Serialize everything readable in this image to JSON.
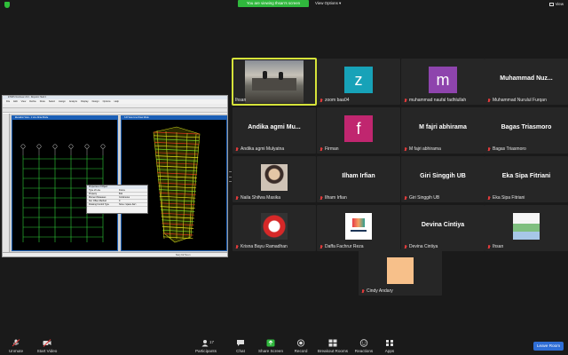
{
  "top": {
    "viewing_label": "You are viewing Ihsan's screen",
    "view_options_label": "View Options ▾",
    "view_label": "View"
  },
  "shared_screen": {
    "app_title": "ETABS Nonlinear v9.0 - fiksjustin Hasil 2",
    "menu": [
      "File",
      "Edit",
      "View",
      "Define",
      "Draw",
      "Select",
      "Assign",
      "Analyze",
      "Display",
      "Design",
      "Options",
      "Help"
    ],
    "pane1_title": "Elevation View - 1 Line Draw Mode",
    "pane2_title": "3-D View  Line Draw Mode",
    "props_title": "Properties of Object",
    "props_rows": [
      [
        "Type of Line",
        "Frame"
      ],
      [
        "Property",
        "B11"
      ],
      [
        "Moment Releases",
        "Continuous"
      ],
      [
        "Rel. Offset Method",
        "0"
      ],
      [
        "Drawing Control Type",
        "None <space bar>"
      ]
    ],
    "status": "Story Kd  Ton-m"
  },
  "participants": [
    {
      "name": "Ihsan",
      "type": "video",
      "speaking": true,
      "muted": false
    },
    {
      "name": "zoom baa04",
      "type": "avatar",
      "initial": "Z",
      "color": "#17a2b8",
      "muted": true
    },
    {
      "name": "muhammad naufal fadhlullah",
      "type": "avatar",
      "initial": "M",
      "color": "#8e44ad",
      "muted": true
    },
    {
      "name": "Muhammad Nurulul Furqan",
      "type": "name",
      "big": "Muhammad  Nuz...",
      "muted": true
    },
    {
      "name": "Andika agmi Mulyatna",
      "type": "name",
      "big": "Andika  agmi  Mu...",
      "muted": true
    },
    {
      "name": "Firman",
      "type": "avatar",
      "initial": "F",
      "color": "#c0266f",
      "muted": true
    },
    {
      "name": "M fajri abhirama",
      "type": "name",
      "big": "M fajri abhirama",
      "muted": true
    },
    {
      "name": "Bagas Triasmoro",
      "type": "name",
      "big": "Bagas Triasmoro",
      "muted": true
    },
    {
      "name": "Naila Shifwa Masika",
      "type": "image",
      "img": "portrait",
      "muted": true
    },
    {
      "name": "Ilham Irfian",
      "type": "name",
      "big": "Ilham Irfian",
      "muted": true
    },
    {
      "name": "Giri Singgih UB",
      "type": "name",
      "big": "Giri Singgih UB",
      "muted": true
    },
    {
      "name": "Eka Sipa Fitriani",
      "type": "name",
      "big": "Eka Sipa Fitriani",
      "muted": true
    },
    {
      "name": "Krisna Bayu Ramadhan",
      "type": "image",
      "img": "badge",
      "muted": true
    },
    {
      "name": "Daffa Fachrur Reza",
      "type": "image",
      "img": "logo",
      "muted": true
    },
    {
      "name": "Devina Cintiya",
      "type": "name",
      "big": "Devina Cintiya",
      "muted": true
    },
    {
      "name": "Ihsan",
      "type": "image",
      "img": "city",
      "muted": true
    },
    {
      "name": "Cindy Andary",
      "type": "image",
      "img": "peach",
      "muted": true
    }
  ],
  "toolbar": {
    "unmute": "Unmute",
    "start_video": "Start Video",
    "participants": "Participants",
    "participants_count": "17",
    "chat": "Chat",
    "share_screen": "Share Screen",
    "record": "Record",
    "breakout": "Breakout Rooms",
    "reactions": "Reactions",
    "apps": "Apps",
    "leave": "Leave Room"
  }
}
